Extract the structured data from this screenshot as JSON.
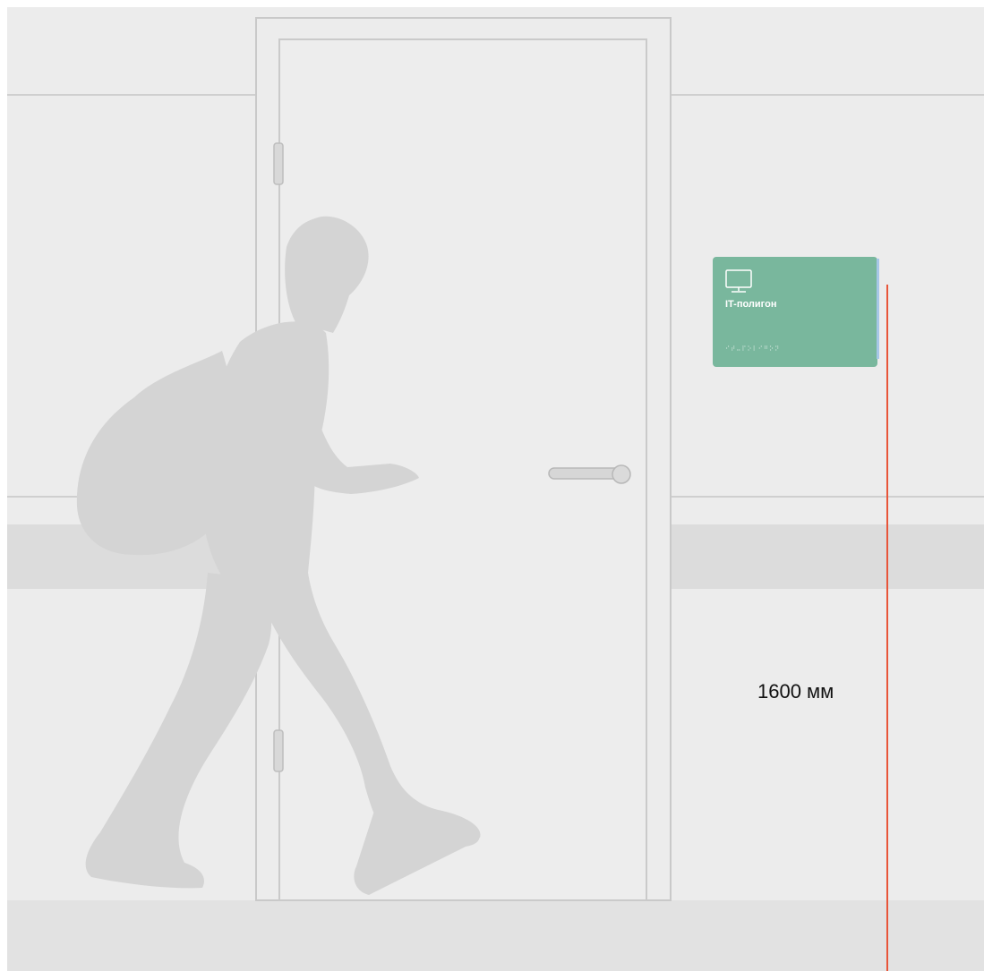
{
  "sign": {
    "icon": "monitor-icon",
    "title": "IT-полигон",
    "braille": "⠊⠞⠤⠏⠕⠇⠊⠛⠕⠝",
    "color": "#79b79d"
  },
  "dimension": {
    "label": "1600 мм",
    "line_color": "#e8553a"
  }
}
